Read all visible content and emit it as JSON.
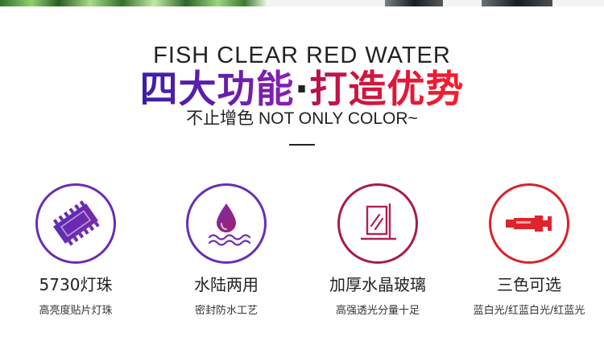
{
  "header": {
    "title_en": "FISH CLEAR RED WATER",
    "title_cn_part1": "四大功能",
    "title_cn_dot": "·",
    "title_cn_part2": "打造优势",
    "subtitle": "不止增色 NOT ONLY COLOR~"
  },
  "features": [
    {
      "icon": "led-strip-icon",
      "name": "5730灯珠",
      "desc": "高亮度贴片灯珠",
      "ring_color": "#6a2db3"
    },
    {
      "icon": "waterproof-drop-icon",
      "name": "水陆两用",
      "desc": "密封防水工艺",
      "ring_color": "#6a2db3"
    },
    {
      "icon": "glass-panel-icon",
      "name": "加厚水晶玻璃",
      "desc": "高强透光分量十足",
      "ring_color": "#a71b4e"
    },
    {
      "icon": "light-tube-icon",
      "name": "三色可选",
      "desc": "蓝白光/红蓝白光/红蓝光",
      "ring_color": "#d9222a"
    }
  ],
  "colors": {
    "purple": "#6a2db3",
    "magenta": "#a71b4e",
    "red": "#e0242b"
  }
}
